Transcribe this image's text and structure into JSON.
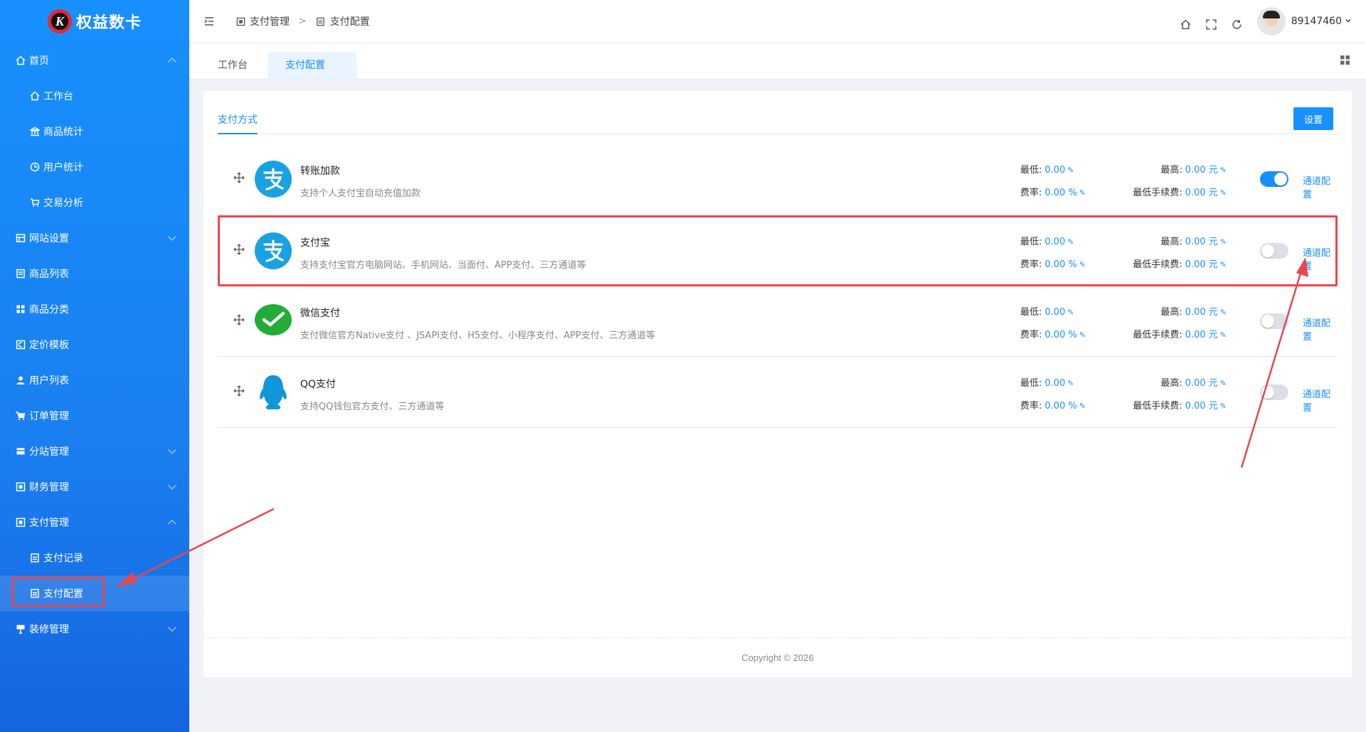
{
  "brand": {
    "name": "权益数卡",
    "mark": "K"
  },
  "sidebar": {
    "items": [
      {
        "label": "首页",
        "icon": "home-icon",
        "expanded": true
      },
      {
        "label": "工作台",
        "icon": "home-icon",
        "sub": true
      },
      {
        "label": "商品统计",
        "icon": "bank-icon",
        "sub": true
      },
      {
        "label": "用户统计",
        "icon": "clock-icon",
        "sub": true
      },
      {
        "label": "交易分析",
        "icon": "cart-icon",
        "sub": true
      },
      {
        "label": "网站设置",
        "icon": "grid-icon",
        "expanded": false
      },
      {
        "label": "商品列表",
        "icon": "list-icon"
      },
      {
        "label": "商品分类",
        "icon": "tiles-icon"
      },
      {
        "label": "定价模板",
        "icon": "template-icon"
      },
      {
        "label": "用户列表",
        "icon": "user-icon"
      },
      {
        "label": "订单管理",
        "icon": "cart-icon"
      },
      {
        "label": "分站管理",
        "icon": "store-icon",
        "expanded": false
      },
      {
        "label": "财务管理",
        "icon": "finance-icon",
        "expanded": false
      },
      {
        "label": "支付管理",
        "icon": "payment-icon",
        "expanded": true
      },
      {
        "label": "支付记录",
        "icon": "record-icon",
        "sub": true
      },
      {
        "label": "支付配置",
        "icon": "record-icon",
        "sub": true,
        "active": true
      },
      {
        "label": "装修管理",
        "icon": "decor-icon",
        "expanded": false
      }
    ]
  },
  "header": {
    "breadcrumb": [
      "支付管理",
      "支付配置"
    ],
    "separator": ">",
    "user": "89147460"
  },
  "tabs": [
    {
      "label": "工作台"
    },
    {
      "label": "支付配置",
      "active": true,
      "close": "×"
    }
  ],
  "card": {
    "tab_label": "支付方式",
    "settings_button": "设置"
  },
  "labels": {
    "min": "最低:",
    "max": "最高:",
    "rate": "费率:",
    "min_fee": "最低手续费:",
    "channel_config": "通道配置"
  },
  "payments": [
    {
      "name": "转账加款",
      "desc": "支持个人支付宝自动充值加款",
      "logo": "alipay-logo",
      "min": "0.00",
      "max": "0.00 元",
      "rate": "0.00 %",
      "min_fee": "0.00 元",
      "enabled": true
    },
    {
      "name": "支付宝",
      "desc": "支持支付宝官方电脑网站、手机网站、当面付、APP支付、三方通道等",
      "logo": "alipay-logo",
      "min": "0.00",
      "max": "0.00 元",
      "rate": "0.00 %",
      "min_fee": "0.00 元",
      "enabled": false
    },
    {
      "name": "微信支付",
      "desc": "支付微信官方Native支付 、JSAPI支付、H5支付、小程序支付、APP支付、三方通道等",
      "logo": "wechat-logo",
      "min": "0.00",
      "max": "0.00 元",
      "rate": "0.00 %",
      "min_fee": "0.00 元",
      "enabled": false
    },
    {
      "name": "QQ支付",
      "desc": "支持QQ钱包官方支付、三方通道等",
      "logo": "qq-logo",
      "min": "0.00",
      "max": "0.00 元",
      "rate": "0.00 %",
      "min_fee": "0.00 元",
      "enabled": false
    }
  ],
  "footer": {
    "text": "Copyright © 2026"
  },
  "colors": {
    "primary": "#1890ff",
    "highlight": "#e8474d",
    "alipay": "#1aa1e3",
    "wechat": "#22ac38",
    "qq": "#1296db"
  }
}
